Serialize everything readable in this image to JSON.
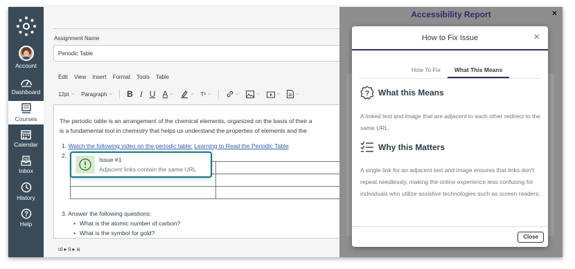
{
  "nav": {
    "items": [
      {
        "label": "Account",
        "icon": "avatar"
      },
      {
        "label": "Dashboard",
        "icon": "dashboard-icon"
      },
      {
        "label": "Courses",
        "icon": "courses-icon"
      },
      {
        "label": "Calendar",
        "icon": "calendar-icon"
      },
      {
        "label": "Inbox",
        "icon": "inbox-icon"
      },
      {
        "label": "History",
        "icon": "history-icon"
      },
      {
        "label": "Help",
        "icon": "help-icon"
      }
    ]
  },
  "editor": {
    "assignment_label": "Assignment Name",
    "assignment_value": "Periodic Table",
    "menus": [
      "Edit",
      "View",
      "Insert",
      "Format",
      "Tools",
      "Table"
    ],
    "toolbar": {
      "font_size": "12pt",
      "block": "Paragraph",
      "superscript": "T²"
    },
    "body": {
      "paragraph_line1": "The periodic table is an arrangement of the chemical elements, organized on the basis of their a",
      "paragraph_line2": "is a fundamental tool in chemistry that helps us understand the properties of elements and the",
      "item1_link": "Watch the following video on the periodic table:",
      "item1_link2": "Learning to Read the Periodic Table",
      "item1_num": "1.",
      "item2_num": "2.",
      "item3": "3. Answer the following questions:",
      "bullets": [
        "What is the atomic number of carbon?",
        "What is the symbol for gold?"
      ]
    },
    "path": "ol ▸ li ▸ a"
  },
  "issue": {
    "title": "Issue #1",
    "description": "Adjacent links contain the same URL"
  },
  "report": {
    "title": "Accessibility Report",
    "close": "×"
  },
  "modal": {
    "title": "How to Fix Issue",
    "close_x": "×",
    "tabs": [
      "How To Fix",
      "What This Means"
    ],
    "what_heading": "What this Means",
    "what_text": "A linked text and image that are adjacent to each other redirect to the same URL.",
    "why_heading": "Why this Matters",
    "why_text": "A single link for an adjacent text and image ensures that links don't repeat needlessly, making the online experience less confusing for individuals who utilize assistive technologies such as screen readers.",
    "close_button": "Close"
  },
  "colors": {
    "nav_bg": "#394b58",
    "accent_purple": "#3a2466",
    "link": "#2d5ea8",
    "issue_border": "#0b7a8a"
  }
}
